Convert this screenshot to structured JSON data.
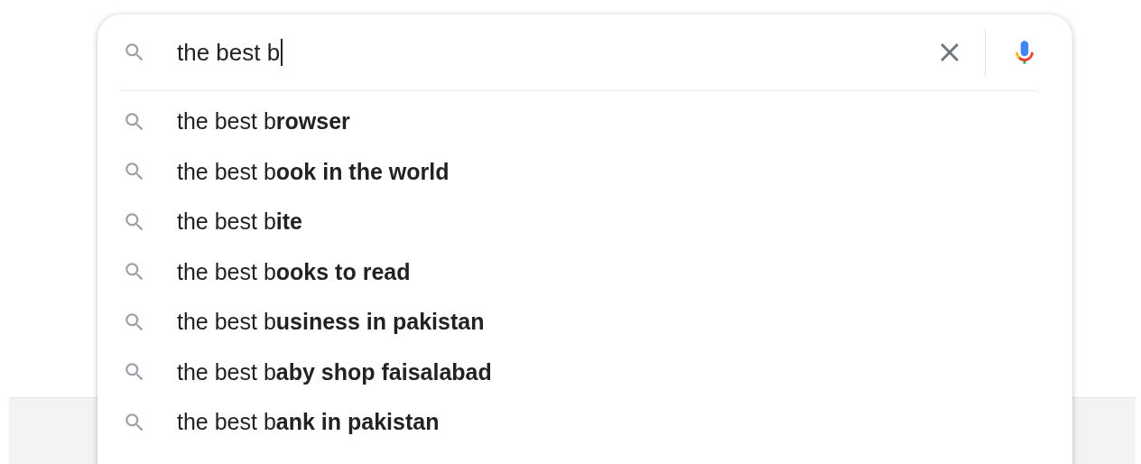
{
  "search": {
    "value": "the best b"
  },
  "suggestions": [
    {
      "text": "the best b**rowser**"
    },
    {
      "text": "the best b**ook in the world**"
    },
    {
      "text": "the best b**ite**"
    },
    {
      "text": "the best b**ooks to read**"
    },
    {
      "text": "the best b**usiness in pakistan**"
    },
    {
      "text": "the best b**aby shop faisalabad**"
    },
    {
      "text": "the best b**ank in pakistan**"
    }
  ]
}
